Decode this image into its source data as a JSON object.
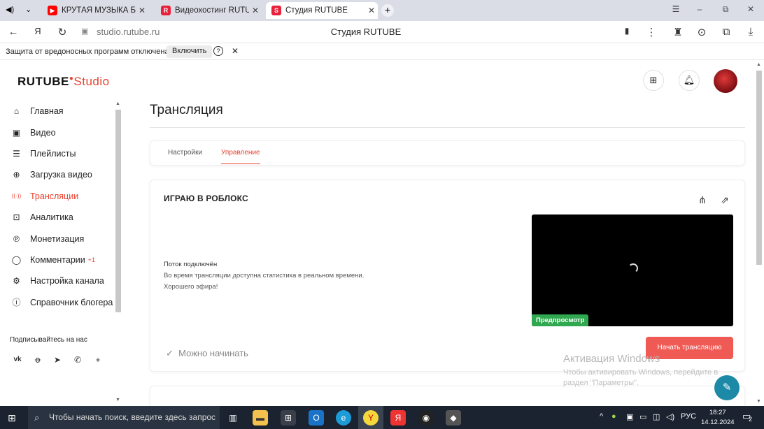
{
  "browser": {
    "tabs": [
      {
        "title": "КРУТАЯ МУЗЫКА Б",
        "favicon": "youtube-icon",
        "color": "#ff0000"
      },
      {
        "title": "Видеохостинг RUTUBE. С",
        "favicon": "rutube-icon",
        "color": "#e8203a"
      },
      {
        "title": "Студия RUTUBE",
        "favicon": "rutube-studio-icon",
        "color": "#e8203a"
      }
    ],
    "url": "studio.rutube.ru",
    "page_title": "Студия RUTUBE"
  },
  "infobar": {
    "text": "Защита от вредоносных программ отключена",
    "button": "Включить",
    "help": "?",
    "close": "✕"
  },
  "app": {
    "logo_main": "RUTUBE",
    "logo_sub": "Studio",
    "nav": [
      {
        "label": "Главная",
        "icon": "home-icon",
        "glyph": "⌂"
      },
      {
        "label": "Видео",
        "icon": "video-icon",
        "glyph": "▣"
      },
      {
        "label": "Плейлисты",
        "icon": "playlist-icon",
        "glyph": "☰"
      },
      {
        "label": "Загрузка видео",
        "icon": "upload-icon",
        "glyph": "⊕"
      },
      {
        "label": "Трансляции",
        "icon": "broadcast-icon",
        "glyph": "((·))",
        "active": true
      },
      {
        "label": "Аналитика",
        "icon": "analytics-icon",
        "glyph": "⊡"
      },
      {
        "label": "Монетизация",
        "icon": "monetization-icon",
        "glyph": "℗"
      },
      {
        "label": "Комментарии",
        "icon": "comments-icon",
        "glyph": "◯",
        "badge": "+1"
      },
      {
        "label": "Настройка канала",
        "icon": "settings-icon",
        "glyph": "⚙"
      },
      {
        "label": "Справочник блогера",
        "icon": "guide-icon",
        "glyph": "ⓘ"
      }
    ],
    "follow_label": "Подписывайтесь на нас",
    "social": [
      "vk-icon",
      "ok-icon",
      "telegram-icon",
      "viber-icon",
      "more-icon"
    ],
    "heading": "Трансляция",
    "page_tabs": [
      "Настройки",
      "Управление"
    ],
    "stream": {
      "title": "ИГРАЮ В РОБЛОКС",
      "status_line1": "Поток подключён",
      "status_line2": "Во время трансляции доступна статистика в реальном времени.",
      "status_line3": "Хорошего эфира!",
      "preview_badge": "Предпросмотр",
      "ready": "Можно начинать",
      "start_button": "Начать трансляцию"
    },
    "watermark_title": "Активация Windows",
    "watermark_line1": "Чтобы активировать Windows, перейдите в",
    "watermark_line2": "раздел \"Параметры\"."
  },
  "taskbar": {
    "search_placeholder": "Чтобы начать поиск, введите здесь запрос",
    "lang": "РУС",
    "time": "18:27",
    "date": "14.12.2024",
    "notifications": "2"
  },
  "colors": {
    "accent": "#e8412f",
    "start": "#ef5a55",
    "preview_badge": "#2fa84f"
  }
}
